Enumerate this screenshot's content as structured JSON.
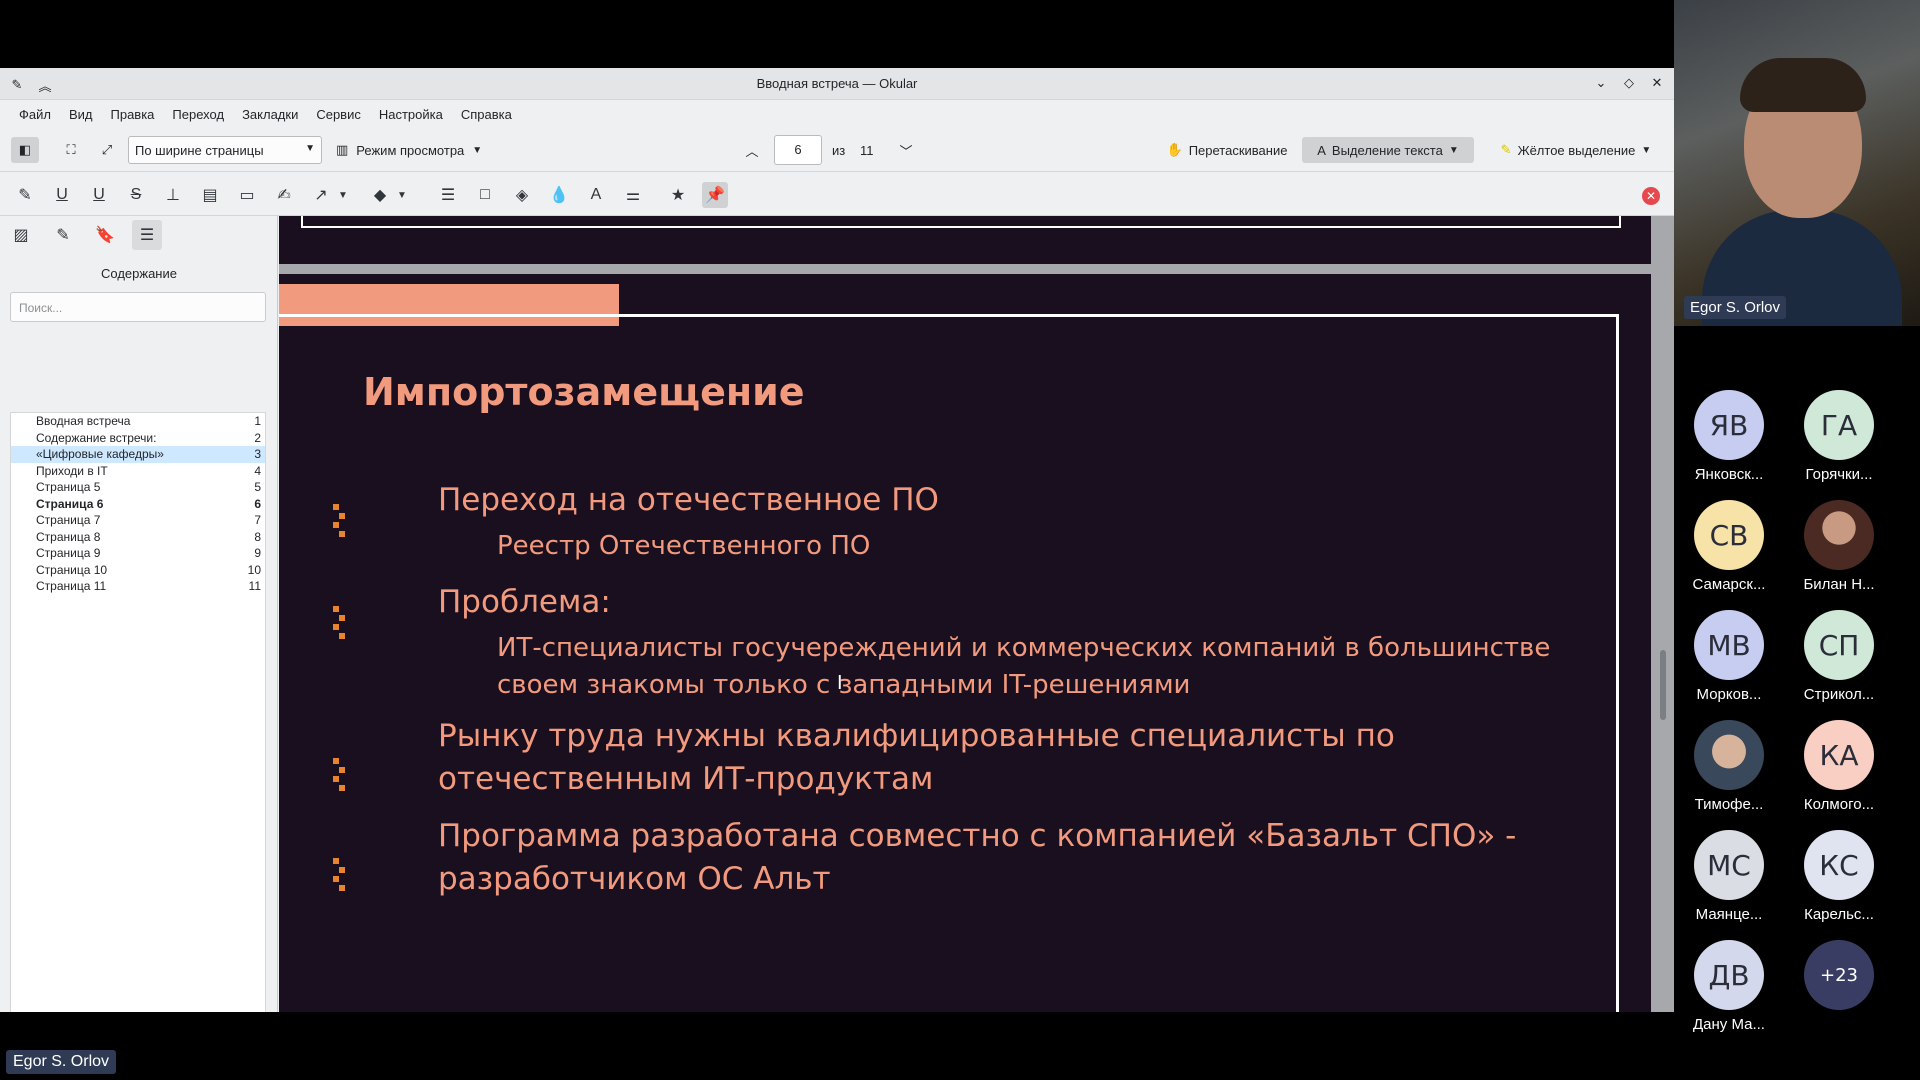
{
  "window": {
    "title": "Вводная встреча — Okular"
  },
  "menu": [
    "Файл",
    "Вид",
    "Правка",
    "Переход",
    "Закладки",
    "Сервис",
    "Настройка",
    "Справка"
  ],
  "toolbar": {
    "zoom_mode": "По ширине страницы",
    "view_mode": "Режим просмотра",
    "page_current": "6",
    "page_of_label": "из",
    "page_total": "11",
    "drag_label": "Перетаскивание",
    "text_select_label": "Выделение текста",
    "highlight_label": "Жёлтое выделение"
  },
  "sidebar": {
    "title": "Содержание",
    "search_placeholder": "Поиск...",
    "toc": [
      {
        "label": "Вводная встреча",
        "page": "1"
      },
      {
        "label": "Содержание встречи:",
        "page": "2"
      },
      {
        "label": "«Цифровые кафедры»",
        "page": "3"
      },
      {
        "label": "Приходи в IT",
        "page": "4"
      },
      {
        "label": "Страница 5",
        "page": "5"
      },
      {
        "label": "Страница 6",
        "page": "6"
      },
      {
        "label": "Страница 7",
        "page": "7"
      },
      {
        "label": "Страница 8",
        "page": "8"
      },
      {
        "label": "Страница 9",
        "page": "9"
      },
      {
        "label": "Страница 10",
        "page": "10"
      },
      {
        "label": "Страница 11",
        "page": "11"
      }
    ]
  },
  "slide": {
    "title": "Импортозамещение",
    "b1": "Переход на отечественное ПО",
    "b1_sub": "Реестр Отечественного ПО",
    "b2": "Проблема:",
    "b2_sub1": "ИТ-специалисты госучереждений и коммерческих компаний в большинстве",
    "b2_sub2": "своем знакомы только с западными IT-решениями",
    "b3_1": "Рынку труда нужны квалифицированные специалисты по",
    "b3_2": "отечественным ИТ-продуктам",
    "b4_1": "Программа разработана совместно с компанией «Базальт СПО» -",
    "b4_2": "разработчиком ОС Альт"
  },
  "call": {
    "speaker_name": "Egor S. Orlov",
    "presenter_name": "Egor S. Orlov",
    "participants": [
      {
        "initials": "ЯВ",
        "name": "Янковск...",
        "color": "#c7cdf0"
      },
      {
        "initials": "ГА",
        "name": "Горячки...",
        "color": "#cfe8d8"
      },
      {
        "initials": "СВ",
        "name": "Самарск...",
        "color": "#f7e3a8"
      },
      {
        "initials": "",
        "name": "Билан Н...",
        "color": "#6b4c45"
      },
      {
        "initials": "МВ",
        "name": "Морков...",
        "color": "#c7cdf0"
      },
      {
        "initials": "СП",
        "name": "Стрикол...",
        "color": "#cfe8d8"
      },
      {
        "initials": "",
        "name": "Тимофе...",
        "color": "#8fa0b8"
      },
      {
        "initials": "КА",
        "name": "Колмого...",
        "color": "#f8cfc2"
      },
      {
        "initials": "МС",
        "name": "Маянце...",
        "color": "#dadde4"
      },
      {
        "initials": "КС",
        "name": "Карельс...",
        "color": "#dfe4f0"
      },
      {
        "initials": "ДВ",
        "name": "Дану Ма...",
        "color": "#d4d8ec"
      },
      {
        "initials": "+23",
        "name": "",
        "color": "#3a3d63"
      }
    ]
  }
}
